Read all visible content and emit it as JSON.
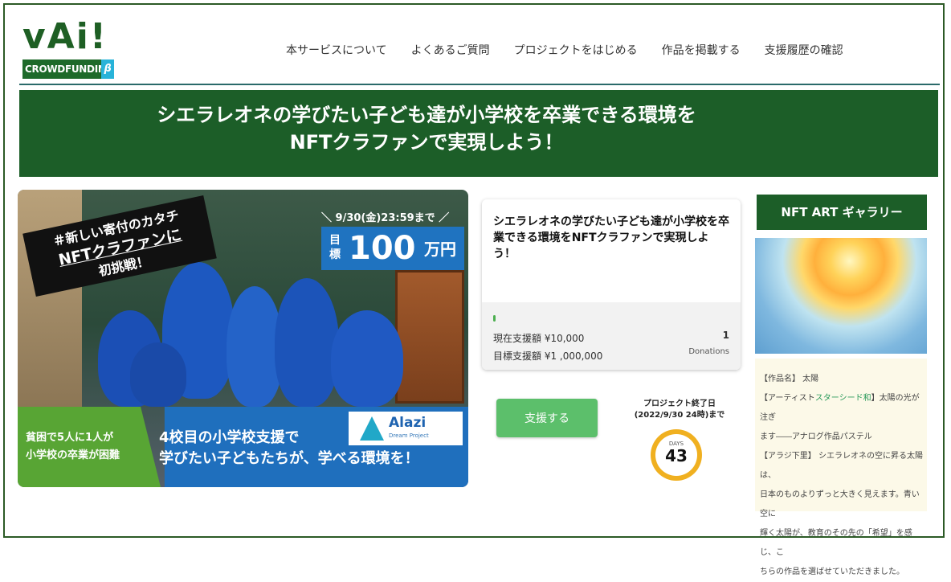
{
  "logo": {
    "word": "vAi!",
    "sub": "CROWDFUNDING",
    "beta": "β"
  },
  "nav": [
    "本サービスについて",
    "よくあるご質問",
    "プロジェクトをはじめる",
    "作品を掲載する",
    "支援履歴の確認"
  ],
  "banner": {
    "line1": "シエラレオネの学びたい子ども達が小学校を卒業できる環境を",
    "line2": "NFTクラファンで実現しよう！"
  },
  "hero": {
    "tag_line1": "＃新しい寄付のカタチ",
    "tag_line2": "NFTクラファンに",
    "tag_line3": "初挑戦！",
    "deadline": "＼ 9/30(金)23:59まで ／",
    "goal_label": "目標",
    "goal_amount": "100",
    "goal_unit": "万円",
    "org_name": "Alazi",
    "org_sub": "Dream Project",
    "green_line1": "貧困で5人に1人が",
    "green_line2": "小学校の卒業が困難",
    "blue_line1": "4校目の小学校支援で",
    "blue_line2": "学びたい子どもたちが、学べる環境を！"
  },
  "card": {
    "title": "シエラレオネの学びたい子ども達が小学校を卒業できる環境をNFTクラファンで実現しよう！",
    "current_label": "現在支援額 ¥10,000",
    "target_label": "目標支援額 ¥1 ,000,000",
    "donations_count": "1",
    "donations_label": "Donations",
    "progress": 0.01
  },
  "support_button": "支援する",
  "end": {
    "label": "プロジェクト終了日",
    "date": "(2022/9/30 24時)まで",
    "days_label": "DAYS",
    "days": "43"
  },
  "gallery": {
    "title": "NFT ART ギャラリー",
    "line1": "【作品名】 太陽",
    "line2_a": "【アーティスト",
    "line2_artist": "スターシード和",
    "line2_b": "】太陽の光が注ぎ",
    "line3": "ます――アナログ作品パステル",
    "line4": "【アラジ下里】 シエラレオネの空に昇る太陽は、",
    "line5": "日本のものよりずっと大きく見えます。青い空に",
    "line6": "輝く太陽が、教育のその先の「希望」を感じ、こ",
    "line7": "ちらの作品を選ばせていただきました。"
  },
  "colors": {
    "brand_green": "#1c5e28",
    "button_green": "#5cbf6b",
    "blue": "#1f6fbd",
    "days_ring": "#f0b020"
  }
}
